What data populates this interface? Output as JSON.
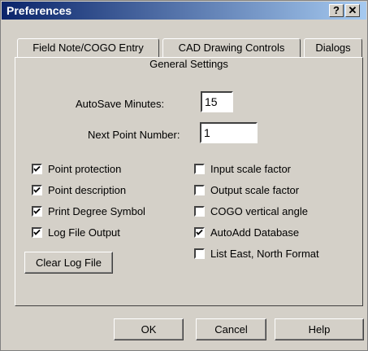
{
  "window": {
    "title": "Preferences",
    "help_button": "?",
    "close_button": "✕"
  },
  "tabs": [
    {
      "label": "Field Note/COGO Entry"
    },
    {
      "label": "CAD Drawing Controls"
    },
    {
      "label": "Dialogs"
    }
  ],
  "panel": {
    "title": "General Settings",
    "autosave": {
      "label": "AutoSave Minutes:",
      "value": "15"
    },
    "next_point": {
      "label": "Next Point Number:",
      "value": "1"
    },
    "left_checks": [
      {
        "label": "Point protection",
        "checked": true
      },
      {
        "label": "Point description",
        "checked": true
      },
      {
        "label": "Print Degree Symbol",
        "checked": true
      },
      {
        "label": "Log File Output",
        "checked": true
      }
    ],
    "right_checks": [
      {
        "label": "Input scale factor",
        "checked": false
      },
      {
        "label": "Output scale factor",
        "checked": false
      },
      {
        "label": "COGO vertical angle",
        "checked": false
      },
      {
        "label": "AutoAdd Database",
        "checked": true
      },
      {
        "label": "List East, North Format",
        "checked": false
      }
    ],
    "clear_log_button": "Clear Log File"
  },
  "buttons": {
    "ok": "OK",
    "cancel": "Cancel",
    "help": "Help"
  }
}
